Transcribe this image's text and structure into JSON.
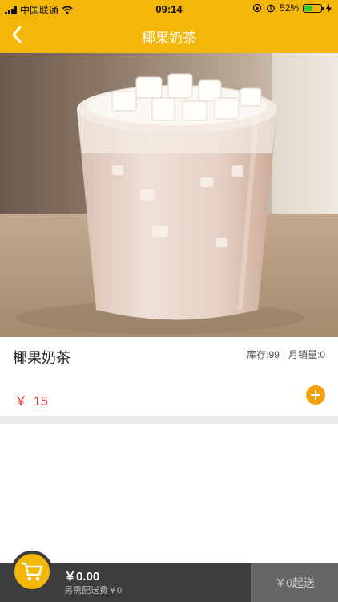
{
  "status_bar": {
    "carrier": "中国联通",
    "time": "09:14",
    "battery_percent": "52%",
    "battery_level": 0.52
  },
  "nav": {
    "title": "椰果奶茶",
    "back_icon": "chevron-left-icon"
  },
  "product": {
    "name": "椰果奶茶",
    "stock_label": "库存:99",
    "sales_label": "月销量:0",
    "currency": "￥",
    "price": "15",
    "add_icon": "plus-circle-icon"
  },
  "cart": {
    "total": "￥0.00",
    "delivery_fee": "另需配送费￥0",
    "min_send": "￥0起送",
    "cart_icon": "shopping-cart-icon"
  },
  "colors": {
    "brand": "#f5b60a",
    "price": "#e32a2a",
    "add_button": "#f5a00a",
    "cart_bar": "#3d3d3d"
  }
}
